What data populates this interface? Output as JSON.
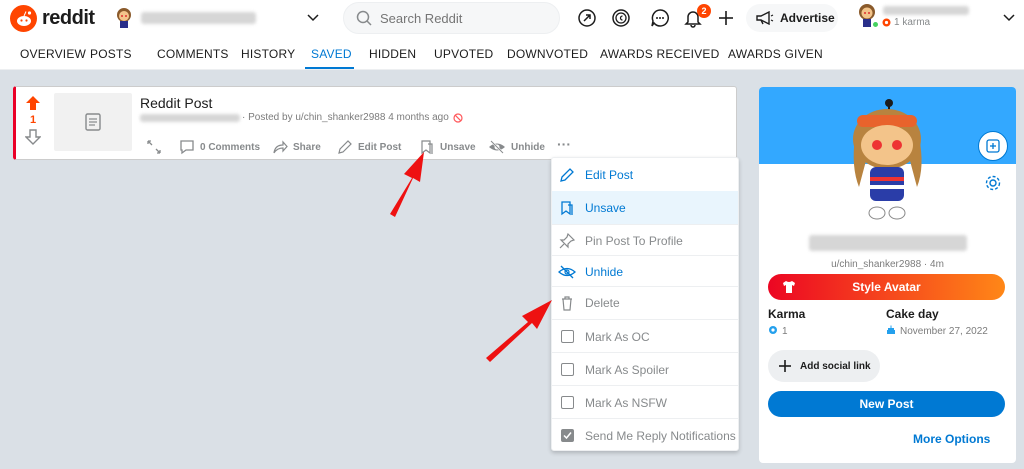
{
  "header": {
    "logo_text": "reddit",
    "search_placeholder": "Search Reddit",
    "notification_count": "2",
    "advertise_label": "Advertise",
    "karma_text": "1 karma"
  },
  "tabs": [
    {
      "label": "OVERVIEW"
    },
    {
      "label": "POSTS"
    },
    {
      "label": "COMMENTS"
    },
    {
      "label": "HISTORY"
    },
    {
      "label": "SAVED"
    },
    {
      "label": "HIDDEN"
    },
    {
      "label": "UPVOTED"
    },
    {
      "label": "DOWNVOTED"
    },
    {
      "label": "AWARDS RECEIVED"
    },
    {
      "label": "AWARDS GIVEN"
    }
  ],
  "post": {
    "vote_count": "1",
    "title": "Reddit Post",
    "meta": "· Posted by u/chin_shanker2988 4 months ago",
    "actions": {
      "comments": "0 Comments",
      "share": "Share",
      "edit": "Edit Post",
      "unsave": "Unsave",
      "unhide": "Unhide",
      "more": "···"
    }
  },
  "menu": {
    "items": [
      {
        "label": "Edit Post"
      },
      {
        "label": "Unsave"
      },
      {
        "label": "Pin Post To Profile"
      },
      {
        "label": "Unhide"
      },
      {
        "label": "Delete"
      },
      {
        "label": "Mark As OC"
      },
      {
        "label": "Mark As Spoiler"
      },
      {
        "label": "Mark As NSFW"
      },
      {
        "label": "Send Me Reply Notifications"
      }
    ]
  },
  "profile": {
    "username": "u/chin_shanker2988 · 4m",
    "style_avatar_label": "Style Avatar",
    "karma_label": "Karma",
    "karma_value": "1",
    "cakeday_label": "Cake day",
    "cakeday_value": "November 27, 2022",
    "add_social_label": "Add social link",
    "new_post_label": "New Post",
    "more_options_label": "More Options"
  },
  "colors": {
    "accent": "#0079d3",
    "orange": "#ff4500",
    "highlight": "#e9f5fd",
    "arrow_red": "#ee1111"
  }
}
